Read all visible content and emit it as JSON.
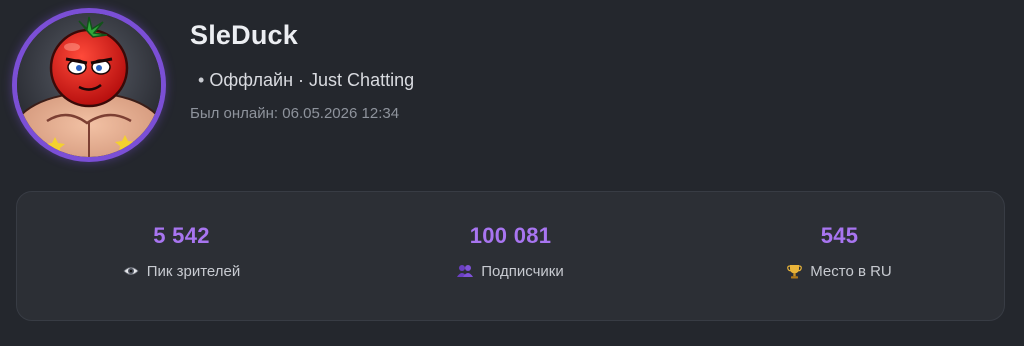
{
  "profile": {
    "username": "SleDuck",
    "status_dot": "•",
    "status_text": "Оффлайн · Just Chatting",
    "last_online": "Был онлайн: 06.05.2026 12:34"
  },
  "stats": [
    {
      "value": "5 542",
      "label": "Пик зрителей",
      "icon": "eye-icon"
    },
    {
      "value": "100 081",
      "label": "Подписчики",
      "icon": "users-icon"
    },
    {
      "value": "545",
      "label": "Место в RU",
      "icon": "trophy-icon"
    }
  ],
  "colors": {
    "background": "#24272d",
    "card": "#2c2f35",
    "accent": "#a875f0",
    "avatar_ring": "#7b4fd6"
  }
}
